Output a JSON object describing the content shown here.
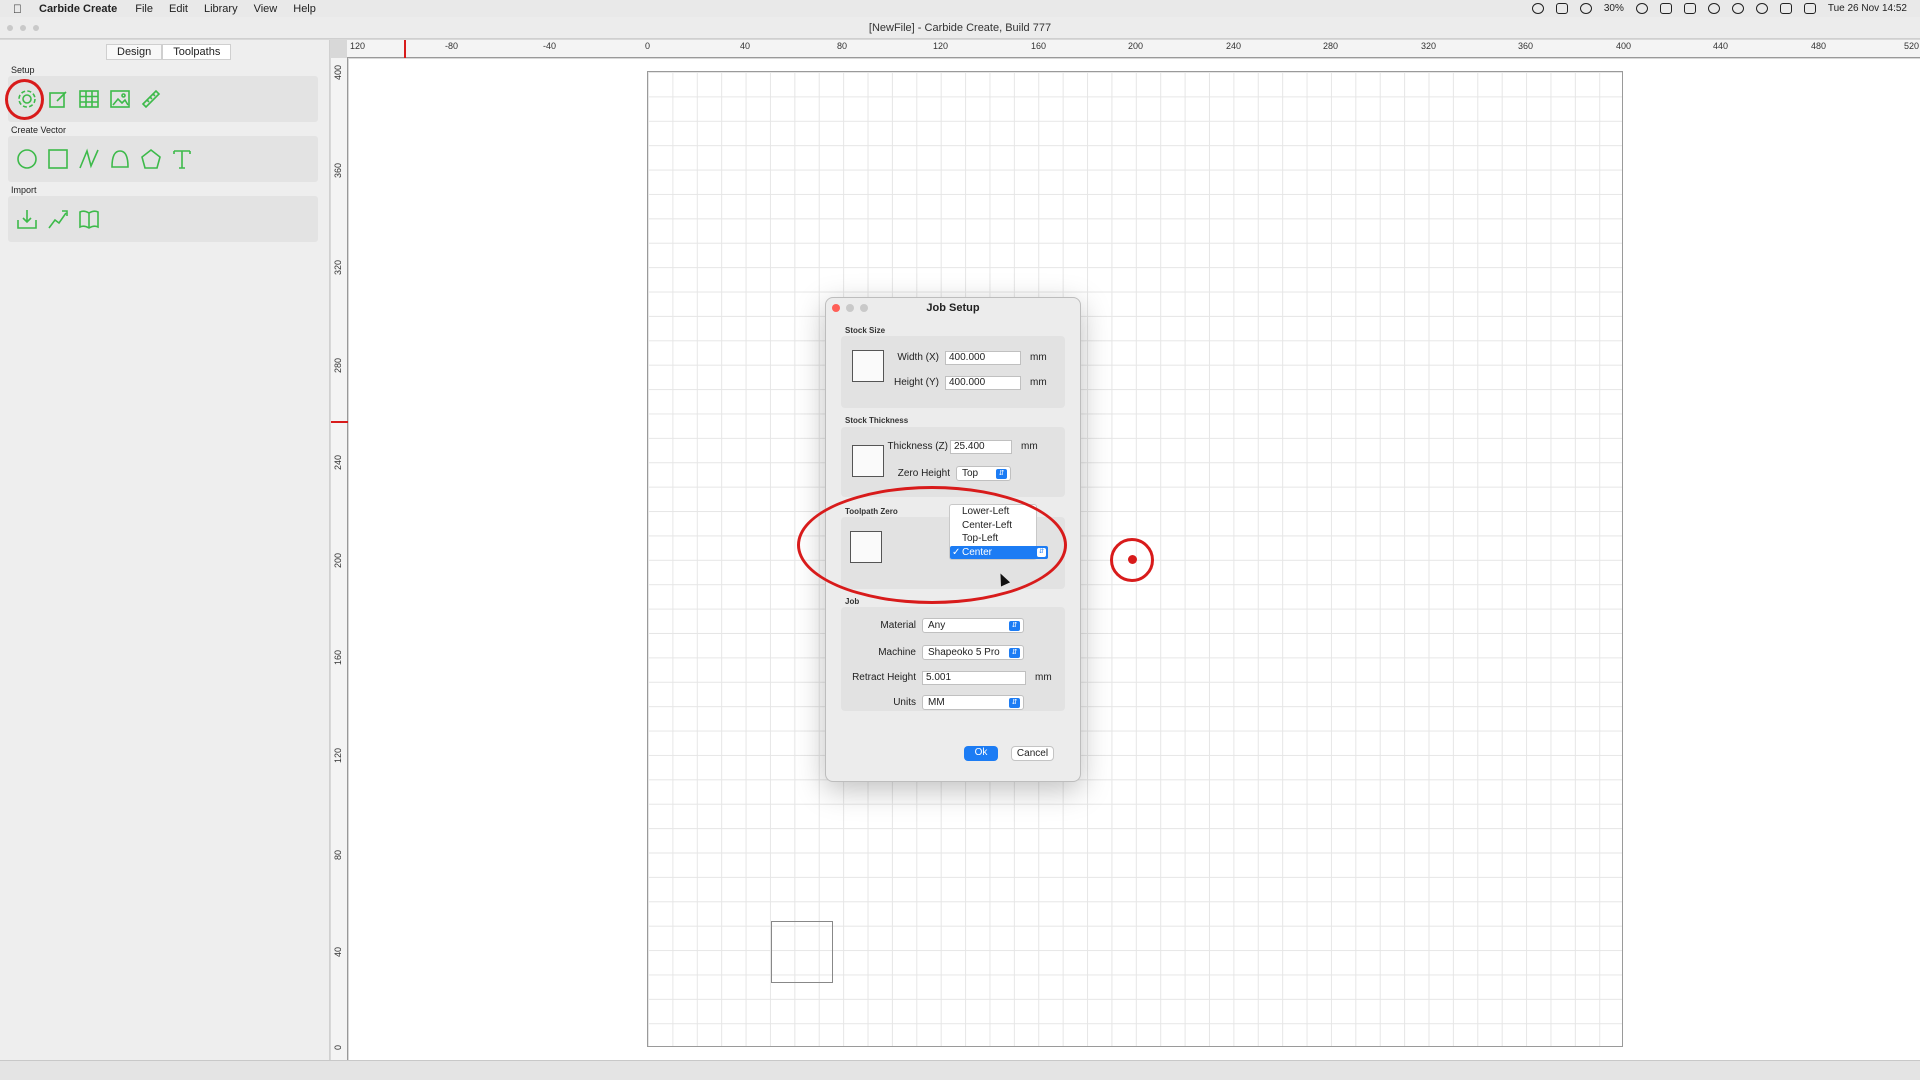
{
  "menubar": {
    "app_name": "Carbide Create",
    "menus": [
      "File",
      "Edit",
      "Library",
      "View",
      "Help"
    ],
    "battery": "30%",
    "datetime": "Tue 26 Nov 14:52"
  },
  "window": {
    "title": "[NewFile] - Carbide Create, Build 777"
  },
  "left_panel": {
    "tabs": [
      "Design",
      "Toolpaths"
    ],
    "sections": {
      "setup": "Setup",
      "create_vector": "Create Vector",
      "import": "Import"
    },
    "setup_tools": [
      "gear-icon",
      "edit-icon",
      "grid-icon",
      "image-icon",
      "ruler-icon"
    ],
    "vector_tools": [
      "circle-icon",
      "rectangle-icon",
      "polyline-icon",
      "curve-icon",
      "polygon-icon",
      "text-icon"
    ],
    "import_tools": [
      "import-svg-icon",
      "import-vector-icon",
      "library-icon"
    ]
  },
  "ruler": {
    "top_ticks": [
      "120",
      "-80",
      "-40",
      "0",
      "40",
      "80",
      "120",
      "160",
      "200",
      "240",
      "280",
      "320",
      "360",
      "400",
      "440",
      "480",
      "520"
    ],
    "left_ticks": [
      "400",
      "360",
      "320",
      "280",
      "240",
      "200",
      "160",
      "120",
      "80",
      "40",
      "0"
    ]
  },
  "dialog": {
    "title": "Job Setup",
    "stock_size": {
      "label": "Stock Size",
      "width_label": "Width (X)",
      "width_value": "400.000",
      "height_label": "Height (Y)",
      "height_value": "400.000",
      "unit": "mm"
    },
    "stock_thickness": {
      "label": "Stock Thickness",
      "thickness_label": "Thickness (Z)",
      "thickness_value": "25.400",
      "unit": "mm",
      "zero_height_label": "Zero Height",
      "zero_height_value": "Top"
    },
    "toolpath_zero": {
      "label": "Toolpath Zero",
      "options": [
        "Lower-Left",
        "Center-Left",
        "Top-Left",
        "Center"
      ],
      "selected": "Center"
    },
    "job": {
      "label": "Job",
      "material_label": "Material",
      "material_value": "Any",
      "machine_label": "Machine",
      "machine_value": "Shapeoko 5 Pro",
      "retract_label": "Retract Height",
      "retract_value": "5.001",
      "retract_unit": "mm",
      "units_label": "Units",
      "units_value": "MM"
    },
    "ok_label": "Ok",
    "cancel_label": "Cancel"
  },
  "colors": {
    "accent": "#1c7cf4",
    "tool_green": "#3dba4a",
    "annotation_red": "#d81b1b"
  }
}
